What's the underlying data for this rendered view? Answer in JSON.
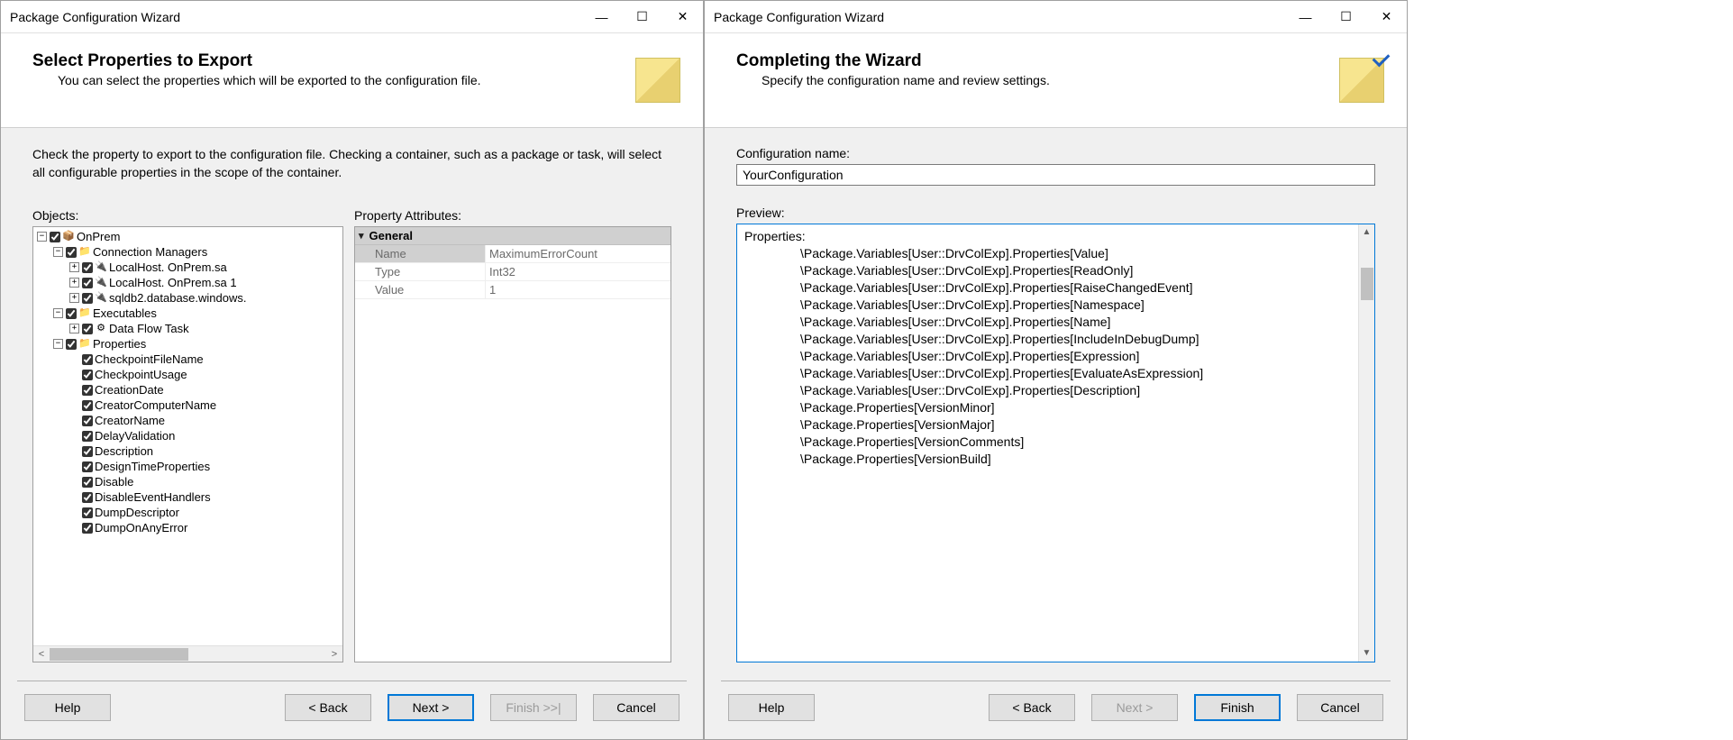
{
  "left": {
    "window_title": "Package Configuration Wizard",
    "header_title": "Select Properties to Export",
    "header_subtitle": "You can select the properties which will be exported to the configuration file.",
    "intro": "Check the property to export to the configuration file. Checking a container, such as a package or task, will select all configurable properties in the scope of the container.",
    "objects_label": "Objects:",
    "attributes_label": "Property Attributes:",
    "tree": [
      {
        "depth": 0,
        "ex": "-",
        "chk": true,
        "icon": "📦",
        "label": "OnPrem"
      },
      {
        "depth": 1,
        "ex": "-",
        "chk": true,
        "icon": "📁",
        "label": "Connection Managers"
      },
      {
        "depth": 2,
        "ex": "+",
        "chk": true,
        "icon": "🔌",
        "label": "LocalHost.                OnPrem.sa"
      },
      {
        "depth": 2,
        "ex": "+",
        "chk": true,
        "icon": "🔌",
        "label": "LocalHost.                OnPrem.sa 1"
      },
      {
        "depth": 2,
        "ex": "+",
        "chk": true,
        "icon": "🔌",
        "label": "                  sqldb2.database.windows."
      },
      {
        "depth": 1,
        "ex": "-",
        "chk": true,
        "icon": "📁",
        "label": "Executables"
      },
      {
        "depth": 2,
        "ex": "+",
        "chk": true,
        "icon": "⚙",
        "label": "Data Flow Task"
      },
      {
        "depth": 1,
        "ex": "-",
        "chk": true,
        "icon": "📁",
        "label": "Properties"
      },
      {
        "depth": 2,
        "ex": " ",
        "chk": true,
        "icon": "",
        "label": "CheckpointFileName"
      },
      {
        "depth": 2,
        "ex": " ",
        "chk": true,
        "icon": "",
        "label": "CheckpointUsage"
      },
      {
        "depth": 2,
        "ex": " ",
        "chk": true,
        "icon": "",
        "label": "CreationDate"
      },
      {
        "depth": 2,
        "ex": " ",
        "chk": true,
        "icon": "",
        "label": "CreatorComputerName"
      },
      {
        "depth": 2,
        "ex": " ",
        "chk": true,
        "icon": "",
        "label": "CreatorName"
      },
      {
        "depth": 2,
        "ex": " ",
        "chk": true,
        "icon": "",
        "label": "DelayValidation"
      },
      {
        "depth": 2,
        "ex": " ",
        "chk": true,
        "icon": "",
        "label": "Description"
      },
      {
        "depth": 2,
        "ex": " ",
        "chk": true,
        "icon": "",
        "label": "DesignTimeProperties"
      },
      {
        "depth": 2,
        "ex": " ",
        "chk": true,
        "icon": "",
        "label": "Disable"
      },
      {
        "depth": 2,
        "ex": " ",
        "chk": true,
        "icon": "",
        "label": "DisableEventHandlers"
      },
      {
        "depth": 2,
        "ex": " ",
        "chk": true,
        "icon": "",
        "label": "DumpDescriptor"
      },
      {
        "depth": 2,
        "ex": " ",
        "chk": true,
        "icon": "",
        "label": "DumpOnAnyError"
      }
    ],
    "propgrid": {
      "section": "General",
      "rows": [
        {
          "k": "Name",
          "v": "MaximumErrorCount",
          "hi": true
        },
        {
          "k": "Type",
          "v": "Int32",
          "hi": false
        },
        {
          "k": "Value",
          "v": "1",
          "hi": false
        }
      ]
    },
    "buttons": {
      "help": "Help",
      "back": "< Back",
      "next": "Next >",
      "finish": "Finish >>|",
      "cancel": "Cancel"
    }
  },
  "right": {
    "window_title": "Package Configuration Wizard",
    "header_title": "Completing the Wizard",
    "header_subtitle": "Specify the configuration name and review settings.",
    "config_name_label": "Configuration name:",
    "config_name_value": "YourConfiguration",
    "preview_label": "Preview:",
    "preview_heading": "Properties:",
    "preview_lines": [
      "\\Package.Variables[User::DrvColExp].Properties[Value]",
      "\\Package.Variables[User::DrvColExp].Properties[ReadOnly]",
      "\\Package.Variables[User::DrvColExp].Properties[RaiseChangedEvent]",
      "\\Package.Variables[User::DrvColExp].Properties[Namespace]",
      "\\Package.Variables[User::DrvColExp].Properties[Name]",
      "\\Package.Variables[User::DrvColExp].Properties[IncludeInDebugDump]",
      "\\Package.Variables[User::DrvColExp].Properties[Expression]",
      "\\Package.Variables[User::DrvColExp].Properties[EvaluateAsExpression]",
      "\\Package.Variables[User::DrvColExp].Properties[Description]",
      "\\Package.Properties[VersionMinor]",
      "\\Package.Properties[VersionMajor]",
      "\\Package.Properties[VersionComments]",
      "\\Package.Properties[VersionBuild]"
    ],
    "buttons": {
      "help": "Help",
      "back": "< Back",
      "next": "Next >",
      "finish": "Finish",
      "cancel": "Cancel"
    }
  }
}
